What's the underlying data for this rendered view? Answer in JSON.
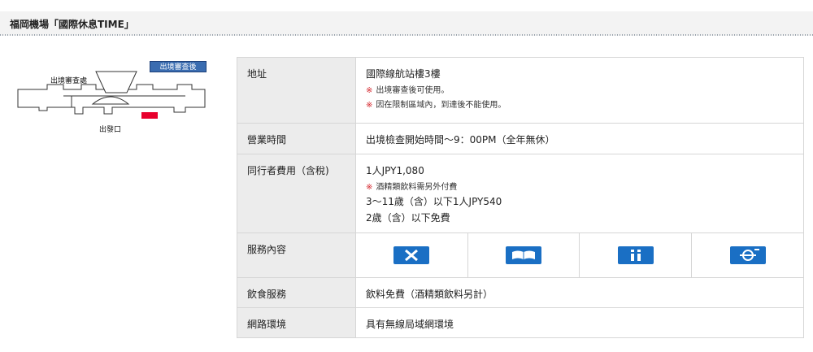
{
  "header": {
    "title": "福岡機場「國際休息TIME」"
  },
  "map": {
    "tag": "出境審查後",
    "label_immigration": "出境審查處",
    "label_exit": "出發口",
    "highlight_color": "#e8002d"
  },
  "info": {
    "rows": [
      {
        "label": "地址",
        "value": "國際線航站樓3樓",
        "notes": [
          "出境審查後可使用。",
          "因在限制區域內，到達後不能使用。"
        ]
      },
      {
        "label": "營業時間",
        "value": "出境檢查開始時間〜9：00PM（全年無休）"
      },
      {
        "label": "同行者費用（含稅)",
        "value": "1人JPY1,080",
        "note": "酒精類飲料需另外付費",
        "extra": [
          "3〜11歲（含）以下1人JPY540",
          "2歲（含）以下免費"
        ]
      },
      {
        "label": "服務內容",
        "icons": [
          "no-smoking-icon",
          "magazine-icon",
          "information-icon",
          "wifi-icon"
        ]
      },
      {
        "label": "飲食服務",
        "value": "飲料免費（酒精類飲料另計）"
      },
      {
        "label": "網路環境",
        "value": "具有無線局域網環境"
      }
    ]
  },
  "colors": {
    "accent": "#1a6fc4",
    "note_mark": "#d4242b",
    "label_bg": "#ececec"
  }
}
